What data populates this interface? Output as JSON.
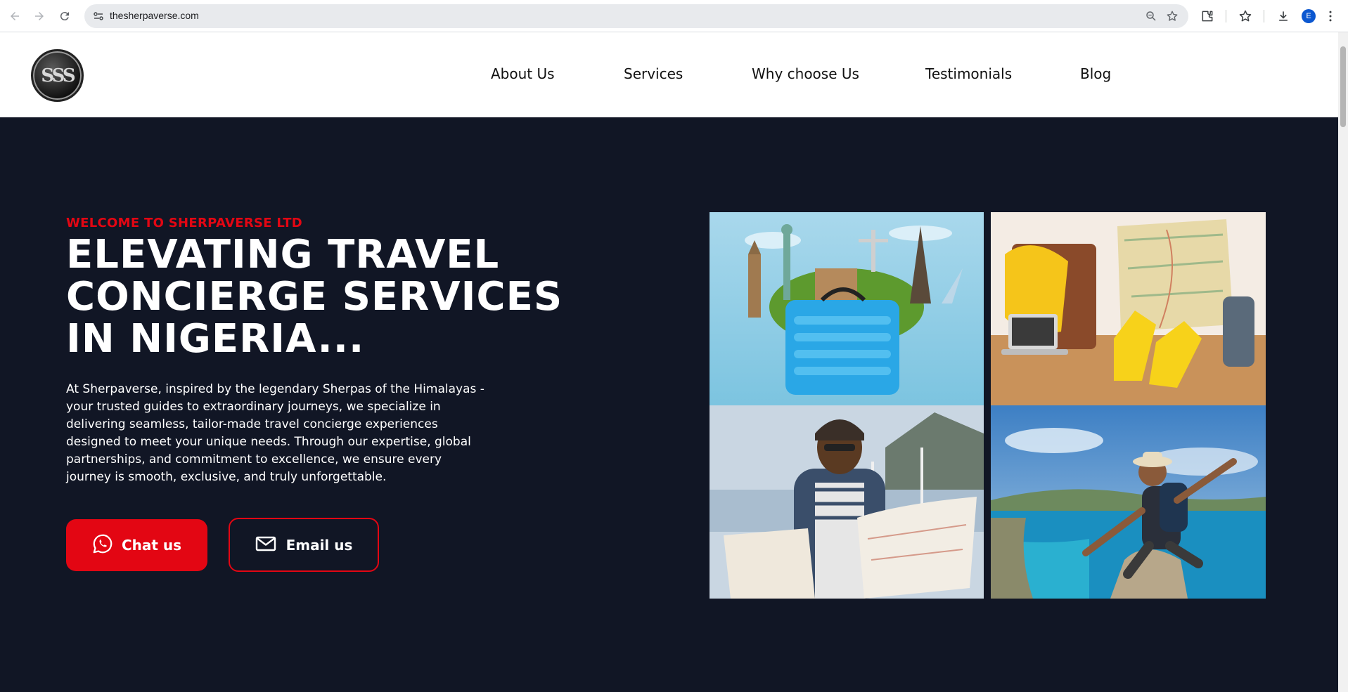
{
  "browser": {
    "url": "thesherpaverse.com",
    "profile_initial": "E"
  },
  "header": {
    "logo_text": "SSS",
    "nav": [
      "About Us",
      "Services",
      "Why choose Us",
      "Testimonials",
      "Blog"
    ]
  },
  "hero": {
    "eyebrow": "WELCOME TO SHERPAVERSE LTD",
    "headline": [
      "ELEVATING TRAVEL",
      "CONCIERGE SERVICES",
      "IN NIGERIA..."
    ],
    "description": "At Sherpaverse, inspired by the legendary Sherpas of the Himalayas - your trusted guides to extraordinary journeys, we specialize in delivering seamless, tailor-made travel concierge experiences designed to meet your unique needs. Through our expertise, global partnerships, and commitment to excellence, we ensure every journey is smooth, exclusive, and truly unforgettable.",
    "chat_label": "Chat us",
    "email_label": "Email us"
  },
  "colors": {
    "accent": "#e30613",
    "hero_bg": "#111625",
    "header_bg": "#ffffff"
  }
}
